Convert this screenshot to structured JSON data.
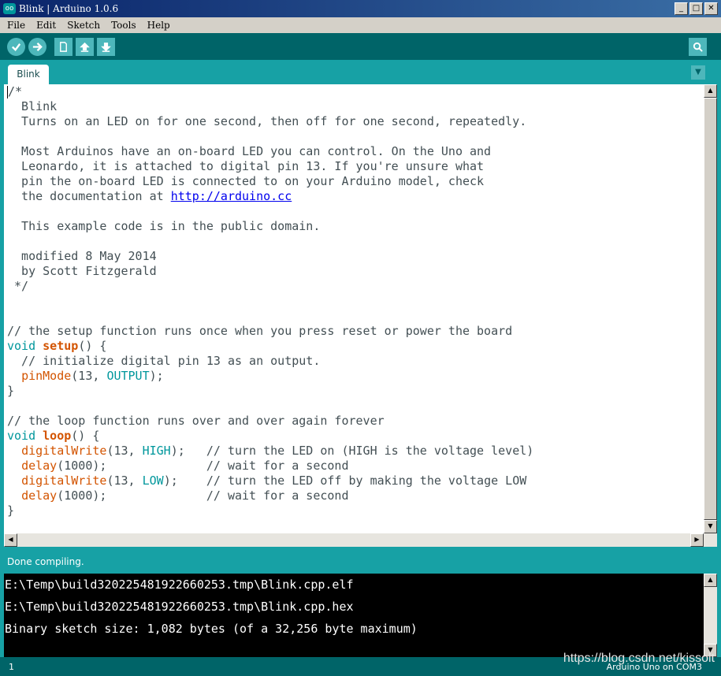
{
  "window": {
    "title": "Blink | Arduino 1.0.6",
    "icon_text": "oo",
    "minimize": "_",
    "maximize": "□",
    "close": "✕"
  },
  "menu": [
    "File",
    "Edit",
    "Sketch",
    "Tools",
    "Help"
  ],
  "toolbar": {
    "buttons": [
      "verify-icon",
      "upload-icon",
      "new-icon",
      "open-icon",
      "save-icon"
    ],
    "serial_monitor": "serial-monitor-icon"
  },
  "tabs": {
    "active": "Blink",
    "menu_arrow": "▼"
  },
  "editor": {
    "lines": [
      {
        "segments": [
          {
            "cls": "cmt",
            "t": "/*"
          }
        ]
      },
      {
        "segments": [
          {
            "cls": "cmt",
            "t": "  Blink"
          }
        ]
      },
      {
        "segments": [
          {
            "cls": "cmt",
            "t": "  Turns on an LED on for one second, then off for one second, repeatedly."
          }
        ]
      },
      {
        "segments": [
          {
            "cls": "cmt",
            "t": ""
          }
        ]
      },
      {
        "segments": [
          {
            "cls": "cmt",
            "t": "  Most Arduinos have an on-board LED you can control. On the Uno and"
          }
        ]
      },
      {
        "segments": [
          {
            "cls": "cmt",
            "t": "  Leonardo, it is attached to digital pin 13. If you're unsure what"
          }
        ]
      },
      {
        "segments": [
          {
            "cls": "cmt",
            "t": "  pin the on-board LED is connected to on your Arduino model, check"
          }
        ]
      },
      {
        "segments": [
          {
            "cls": "cmt",
            "t": "  the documentation at "
          },
          {
            "cls": "lnk",
            "t": "http://arduino.cc"
          }
        ]
      },
      {
        "segments": [
          {
            "cls": "cmt",
            "t": ""
          }
        ]
      },
      {
        "segments": [
          {
            "cls": "cmt",
            "t": "  This example code is in the public domain."
          }
        ]
      },
      {
        "segments": [
          {
            "cls": "cmt",
            "t": ""
          }
        ]
      },
      {
        "segments": [
          {
            "cls": "cmt",
            "t": "  modified 8 May 2014"
          }
        ]
      },
      {
        "segments": [
          {
            "cls": "cmt",
            "t": "  by Scott Fitzgerald"
          }
        ]
      },
      {
        "segments": [
          {
            "cls": "cmt",
            "t": " */"
          }
        ]
      },
      {
        "segments": [
          {
            "cls": "cmt",
            "t": ""
          }
        ]
      },
      {
        "segments": [
          {
            "cls": "cmt",
            "t": ""
          }
        ]
      },
      {
        "segments": [
          {
            "cls": "cmt",
            "t": "// the setup function runs once when you press reset or power the board"
          }
        ]
      },
      {
        "segments": [
          {
            "cls": "kw",
            "t": "void"
          },
          {
            "cls": "",
            "t": " "
          },
          {
            "cls": "fnb",
            "t": "setup"
          },
          {
            "cls": "",
            "t": "() {"
          }
        ]
      },
      {
        "segments": [
          {
            "cls": "cmt",
            "t": "  // initialize digital pin 13 as an output."
          }
        ]
      },
      {
        "segments": [
          {
            "cls": "",
            "t": "  "
          },
          {
            "cls": "fn",
            "t": "pinMode"
          },
          {
            "cls": "",
            "t": "(13, "
          },
          {
            "cls": "const",
            "t": "OUTPUT"
          },
          {
            "cls": "",
            "t": ");"
          }
        ]
      },
      {
        "segments": [
          {
            "cls": "",
            "t": "}"
          }
        ]
      },
      {
        "segments": [
          {
            "cls": "",
            "t": ""
          }
        ]
      },
      {
        "segments": [
          {
            "cls": "cmt",
            "t": "// the loop function runs over and over again forever"
          }
        ]
      },
      {
        "segments": [
          {
            "cls": "kw",
            "t": "void"
          },
          {
            "cls": "",
            "t": " "
          },
          {
            "cls": "fnb",
            "t": "loop"
          },
          {
            "cls": "",
            "t": "() {"
          }
        ]
      },
      {
        "segments": [
          {
            "cls": "",
            "t": "  "
          },
          {
            "cls": "fn",
            "t": "digitalWrite"
          },
          {
            "cls": "",
            "t": "(13, "
          },
          {
            "cls": "const",
            "t": "HIGH"
          },
          {
            "cls": "",
            "t": ");   "
          },
          {
            "cls": "cmt",
            "t": "// turn the LED on (HIGH is the voltage level)"
          }
        ]
      },
      {
        "segments": [
          {
            "cls": "",
            "t": "  "
          },
          {
            "cls": "fn",
            "t": "delay"
          },
          {
            "cls": "",
            "t": "(1000);              "
          },
          {
            "cls": "cmt",
            "t": "// wait for a second"
          }
        ]
      },
      {
        "segments": [
          {
            "cls": "",
            "t": "  "
          },
          {
            "cls": "fn",
            "t": "digitalWrite"
          },
          {
            "cls": "",
            "t": "(13, "
          },
          {
            "cls": "const",
            "t": "LOW"
          },
          {
            "cls": "",
            "t": ");    "
          },
          {
            "cls": "cmt",
            "t": "// turn the LED off by making the voltage LOW"
          }
        ]
      },
      {
        "segments": [
          {
            "cls": "",
            "t": "  "
          },
          {
            "cls": "fn",
            "t": "delay"
          },
          {
            "cls": "",
            "t": "(1000);              "
          },
          {
            "cls": "cmt",
            "t": "// wait for a second"
          }
        ]
      },
      {
        "segments": [
          {
            "cls": "",
            "t": "}"
          }
        ]
      }
    ]
  },
  "status": {
    "message": "Done compiling."
  },
  "console": {
    "lines": [
      "E:\\Temp\\build320225481922660253.tmp\\Blink.cpp.elf",
      "E:\\Temp\\build320225481922660253.tmp\\Blink.cpp.hex",
      "Binary sketch size: 1,082 bytes (of a 32,256 byte maximum)"
    ]
  },
  "footer": {
    "line_number": "1",
    "board": "Arduino Uno on COM3"
  },
  "watermark": "https://blog.csdn.net/kissolt",
  "colors": {
    "teal_dark": "#006468",
    "teal": "#17a1a5",
    "button": "#4db7bb",
    "keyword": "#00979c",
    "function": "#d35400"
  }
}
